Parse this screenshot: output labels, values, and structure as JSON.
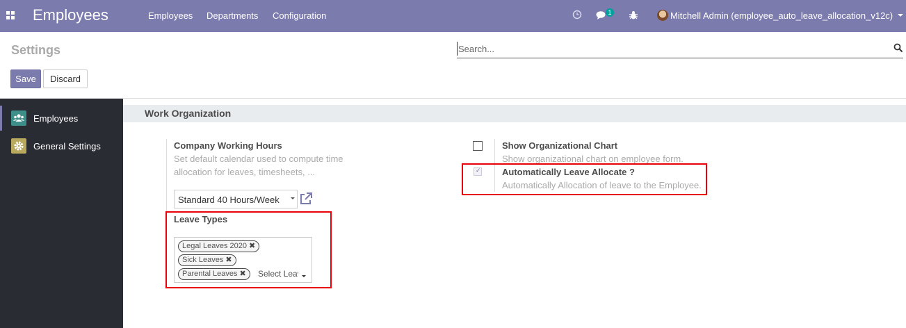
{
  "navbar": {
    "app_title": "Employees",
    "menu": [
      "Employees",
      "Departments",
      "Configuration"
    ],
    "messages_count": "1",
    "user_name": "Mitchell Admin (employee_auto_leave_allocation_v12c)",
    "accent_color": "#7c7bad"
  },
  "control_panel": {
    "title": "Settings",
    "search_placeholder": "Search...",
    "save_label": "Save",
    "discard_label": "Discard"
  },
  "sidebar": {
    "items": [
      {
        "label": "Employees",
        "icon": "users-icon",
        "active": true
      },
      {
        "label": "General Settings",
        "icon": "gear-icon",
        "active": false
      }
    ]
  },
  "section": {
    "title": "Work Organization",
    "working_hours": {
      "label": "Company Working Hours",
      "help_line1": "Set default calendar used to compute time",
      "help_line2": "allocation for leaves, timesheets, ...",
      "value": "Standard 40 Hours/Week"
    },
    "leave_types": {
      "label": "Leave Types",
      "tags": [
        "Legal Leaves 2020",
        "Sick Leaves",
        "Parental Leaves"
      ],
      "placeholder": "Select Leave Types"
    },
    "org_chart": {
      "label": "Show Organizational Chart",
      "help": "Show organizational chart on employee form.",
      "checked": false
    },
    "auto_allocate": {
      "label": "Automatically Leave Allocate ?",
      "help": "Automatically Allocation of leave to the Employee.",
      "checked": true
    }
  }
}
